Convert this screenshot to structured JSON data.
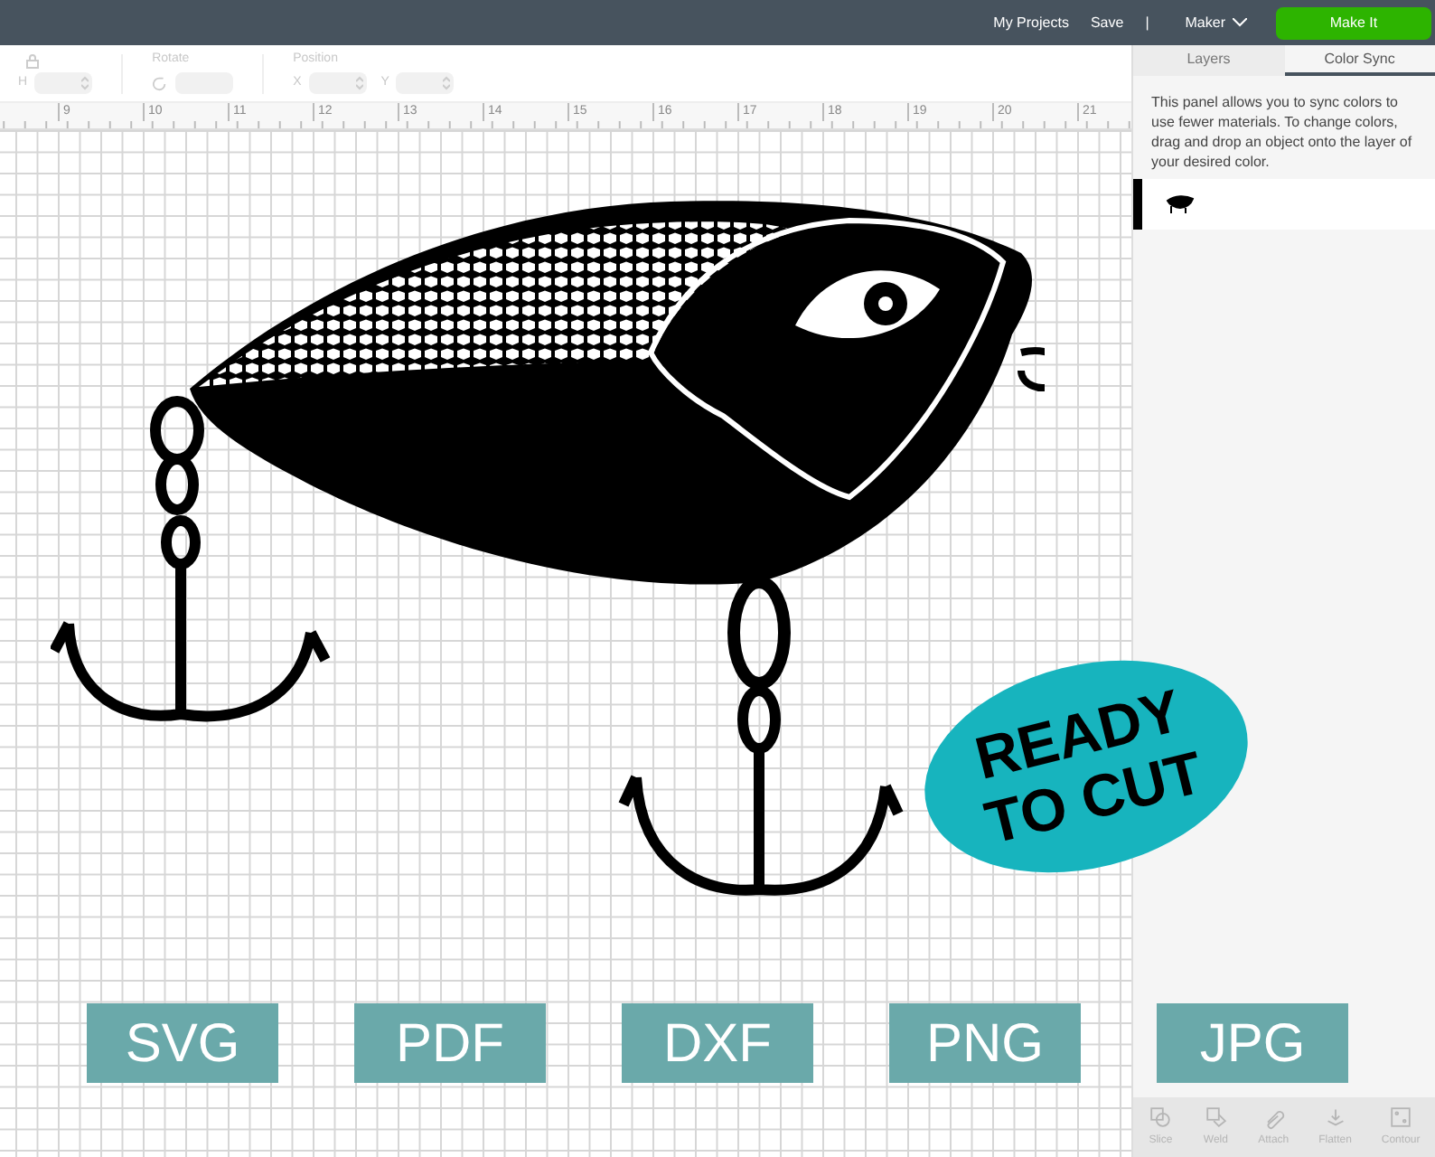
{
  "header": {
    "links": [
      "My Projects",
      "Save"
    ],
    "separator": "|",
    "machine": "Maker",
    "make_it": "Make It"
  },
  "toolbar": {
    "size_field": {
      "label": "H"
    },
    "rotate": {
      "label": "Rotate"
    },
    "position": {
      "label": "Position",
      "fields": [
        {
          "label": "X"
        },
        {
          "label": "Y"
        }
      ]
    }
  },
  "ruler": [
    "9",
    "10",
    "11",
    "12",
    "13",
    "14",
    "15",
    "16",
    "17",
    "18",
    "19",
    "20",
    "21"
  ],
  "panel": {
    "tabs": [
      {
        "label": "Layers",
        "selected": false
      },
      {
        "label": "Color Sync",
        "selected": true
      }
    ],
    "description": "This panel allows you to sync colors to use fewer materials. To change colors, drag and drop an object onto the layer of your desired color.",
    "tools": [
      {
        "label": "Slice",
        "disabled": true
      },
      {
        "label": "Weld",
        "disabled": true
      },
      {
        "label": "Attach",
        "disabled": true
      },
      {
        "label": "Flatten",
        "disabled": true
      },
      {
        "label": "Contour",
        "disabled": true
      }
    ]
  },
  "promo": {
    "badge": [
      "READY",
      "TO CUT"
    ],
    "formats": [
      "SVG",
      "PDF",
      "DXF",
      "PNG",
      "JPG"
    ]
  }
}
